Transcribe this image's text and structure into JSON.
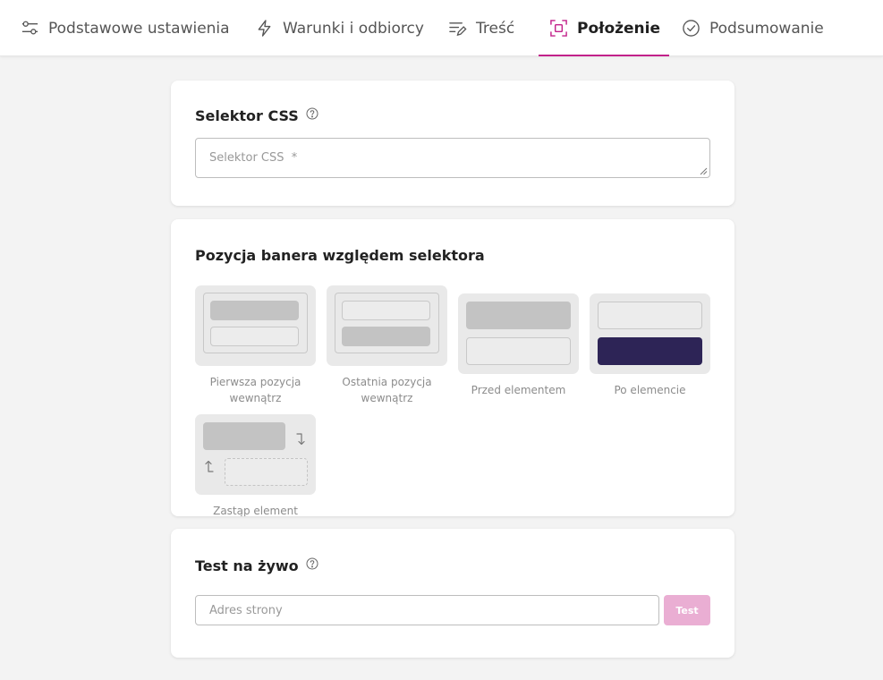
{
  "tabs": [
    {
      "label": "Podstawowe ustawienia",
      "icon": "sliders-icon"
    },
    {
      "label": "Warunki i odbiorcy",
      "icon": "lightning-icon"
    },
    {
      "label": "Treść",
      "icon": "text-edit-icon"
    },
    {
      "label": "Położenie",
      "icon": "position-frame-icon",
      "active": true
    },
    {
      "label": "Podsumowanie",
      "icon": "check-circle-icon"
    }
  ],
  "selector_card": {
    "title": "Selektor CSS",
    "placeholder": "Selektor CSS  *"
  },
  "position_card": {
    "title": "Pozycja banera względem selektora",
    "options": [
      {
        "label_lines": [
          "Pierwsza pozycja",
          "wewnątrz"
        ]
      },
      {
        "label_lines": [
          "Ostatnia pozycja",
          "wewnątrz"
        ]
      },
      {
        "label_lines": [
          "Przed elementem"
        ]
      },
      {
        "label_lines": [
          "Po elemencie"
        ],
        "selected": true
      },
      {
        "label_lines": [
          "Zastąp element"
        ]
      }
    ]
  },
  "live_test_card": {
    "title": "Test na żywo",
    "url_placeholder": "Adres strony",
    "test_button": "Test"
  },
  "colors": {
    "accent": "#c2218a",
    "selected_block": "#2d2456",
    "button_disabled": "#eaaed3"
  }
}
